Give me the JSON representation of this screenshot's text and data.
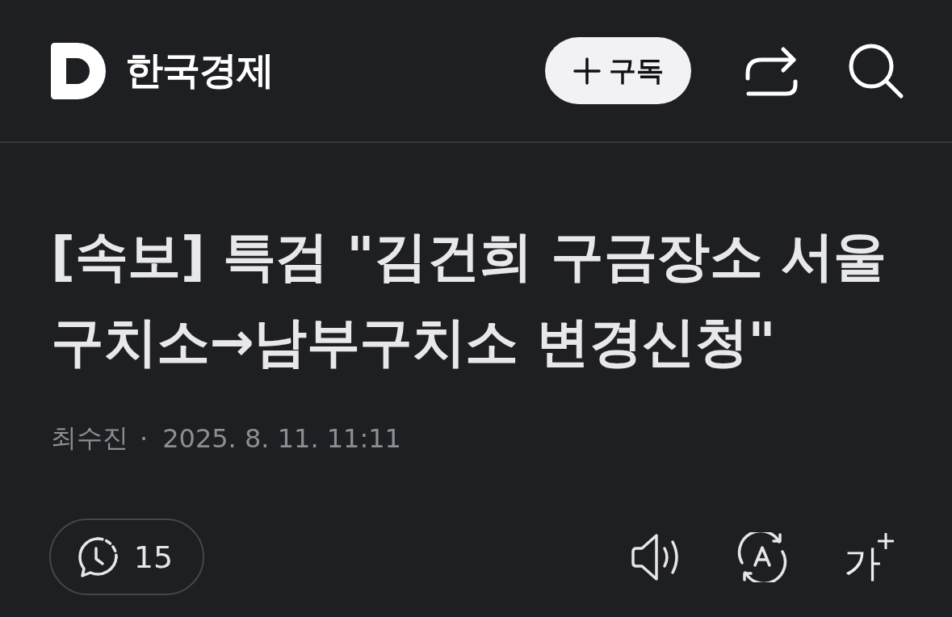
{
  "header": {
    "publisher": "한국경제",
    "subscribe_button": {
      "label": "구독"
    }
  },
  "article": {
    "headline": "[속보] 특검 \"김건희 구금장소 서울 구치소→남부구치소 변경신청\"",
    "author": "최수진",
    "separator": "·",
    "date": "2025. 8. 11. 11:11"
  },
  "toolbar": {
    "comments": {
      "count": "15"
    },
    "font_size_button": {
      "label": "가"
    }
  }
}
